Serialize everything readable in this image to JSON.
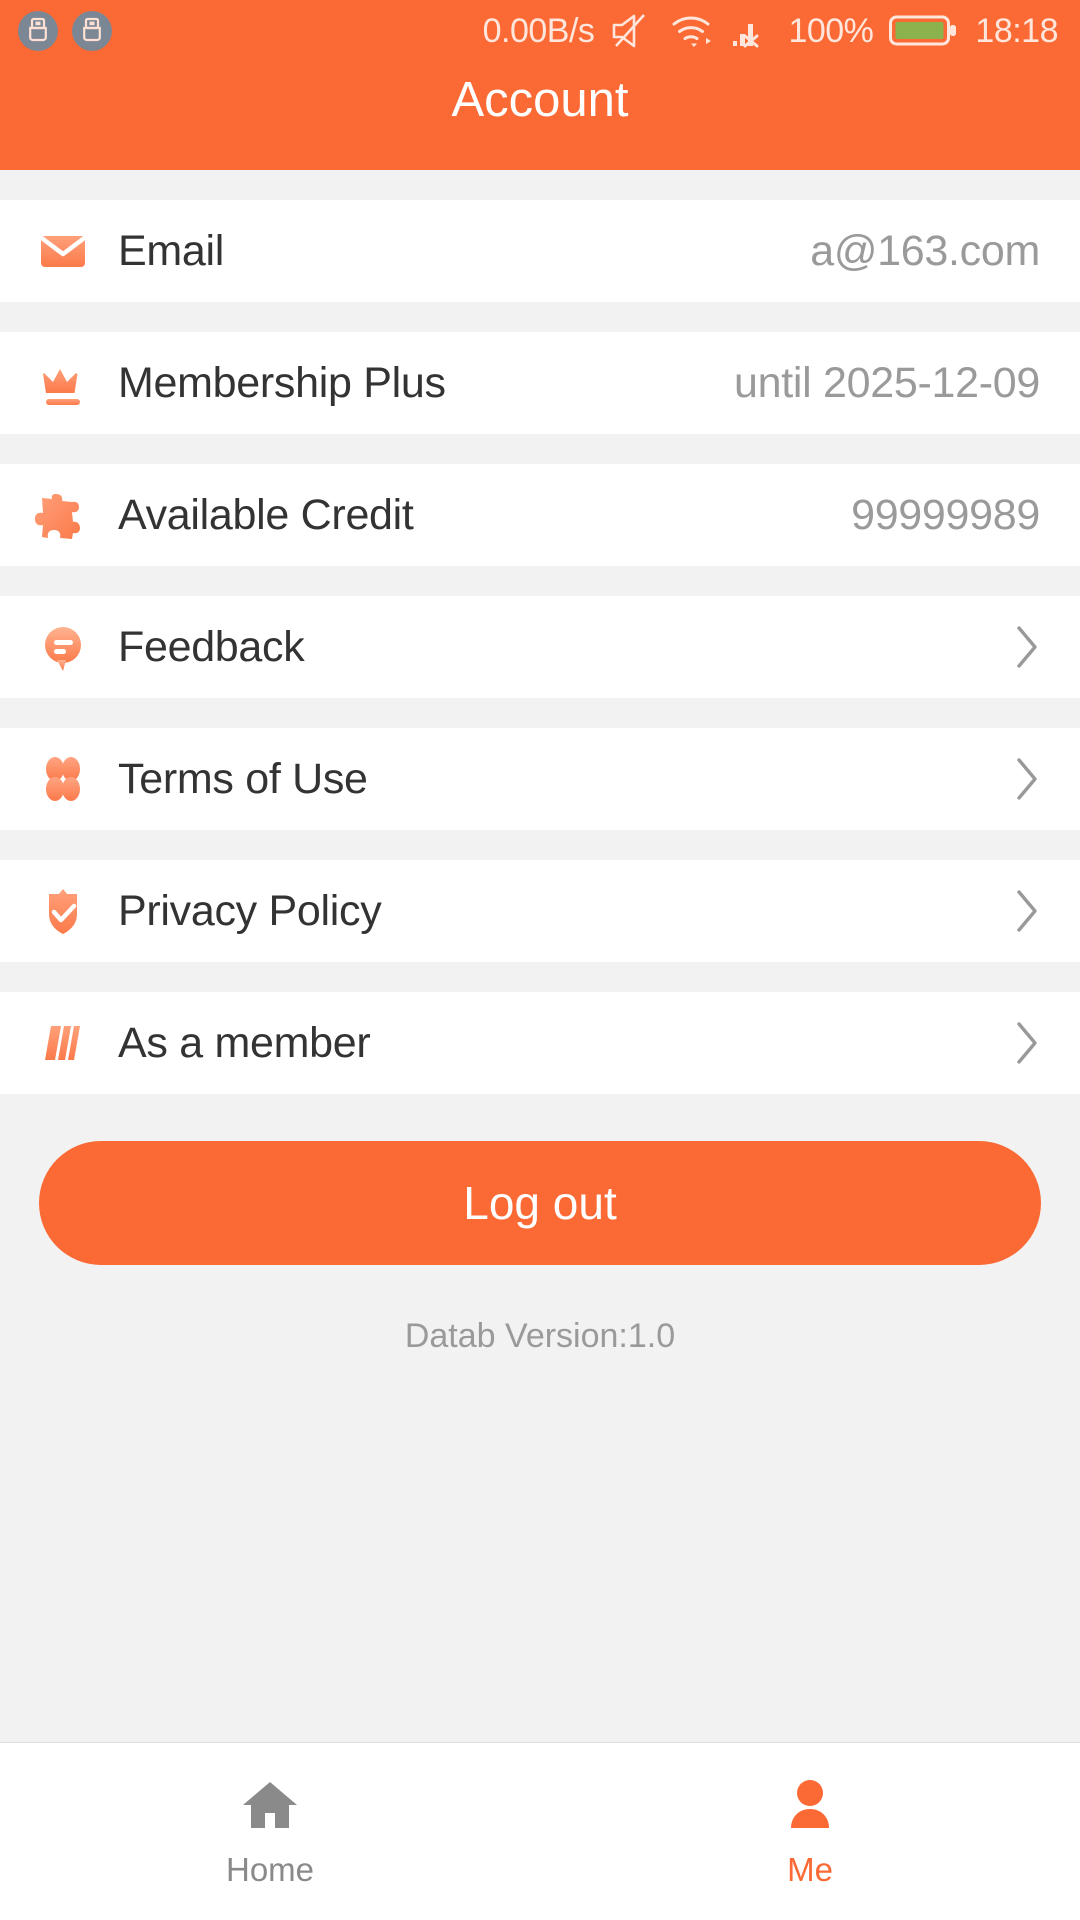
{
  "colors": {
    "brand_orange": "#FB6A34",
    "icon_orange": "#FB8A5F",
    "page_bg": "#F2F2F2",
    "row_bg": "#FFFFFF",
    "label": "#333333",
    "value_gray": "#9A9A9A",
    "battery_green": "#8CB24E",
    "status_text": "#FFE6DC",
    "nav_inactive": "#8A8A8A"
  },
  "statusbar": {
    "usb_icons": [
      "usb-debug-icon",
      "usb-debug-icon"
    ],
    "network_speed": "0.00B/s",
    "mute_icon": "volume-mute-icon",
    "wifi_icon": "wifi-icon",
    "signal_icon": "cellular-no-service-icon",
    "battery_percent": "100%",
    "battery_icon": "battery-full-icon",
    "time": "18:18"
  },
  "header": {
    "title": "Account"
  },
  "rows": [
    {
      "label": "Email",
      "value": "a@163.com",
      "icon": "envelope-icon",
      "name": "row-email",
      "has_chevron": false
    },
    {
      "label": "Membership Plus",
      "value": "until 2025-12-09",
      "icon": "crown-icon",
      "name": "row-membership-plus",
      "has_chevron": false
    },
    {
      "label": "Available Credit",
      "value": "99999989",
      "icon": "puzzle-piece-icon",
      "name": "row-available-credit",
      "has_chevron": false
    },
    {
      "label": "Feedback",
      "value": "",
      "icon": "speech-bubble-icon",
      "name": "row-feedback",
      "has_chevron": true
    },
    {
      "label": "Terms of Use",
      "value": "",
      "icon": "four-petal-clover-icon",
      "name": "row-terms-of-use",
      "has_chevron": true
    },
    {
      "label": "Privacy Policy",
      "value": "",
      "icon": "shield-check-icon",
      "name": "row-privacy-policy",
      "has_chevron": true
    },
    {
      "label": "As a member",
      "value": "",
      "icon": "slanted-bars-icon",
      "name": "row-as-a-member",
      "has_chevron": true
    }
  ],
  "footer": {
    "logout_label": "Log out",
    "version_text": "Datab Version:1.0"
  },
  "bottomnav": {
    "items": [
      {
        "label": "Home",
        "icon": "home-icon",
        "active": false,
        "name": "nav-home"
      },
      {
        "label": "Me",
        "icon": "person-icon",
        "active": true,
        "name": "nav-me"
      }
    ]
  }
}
